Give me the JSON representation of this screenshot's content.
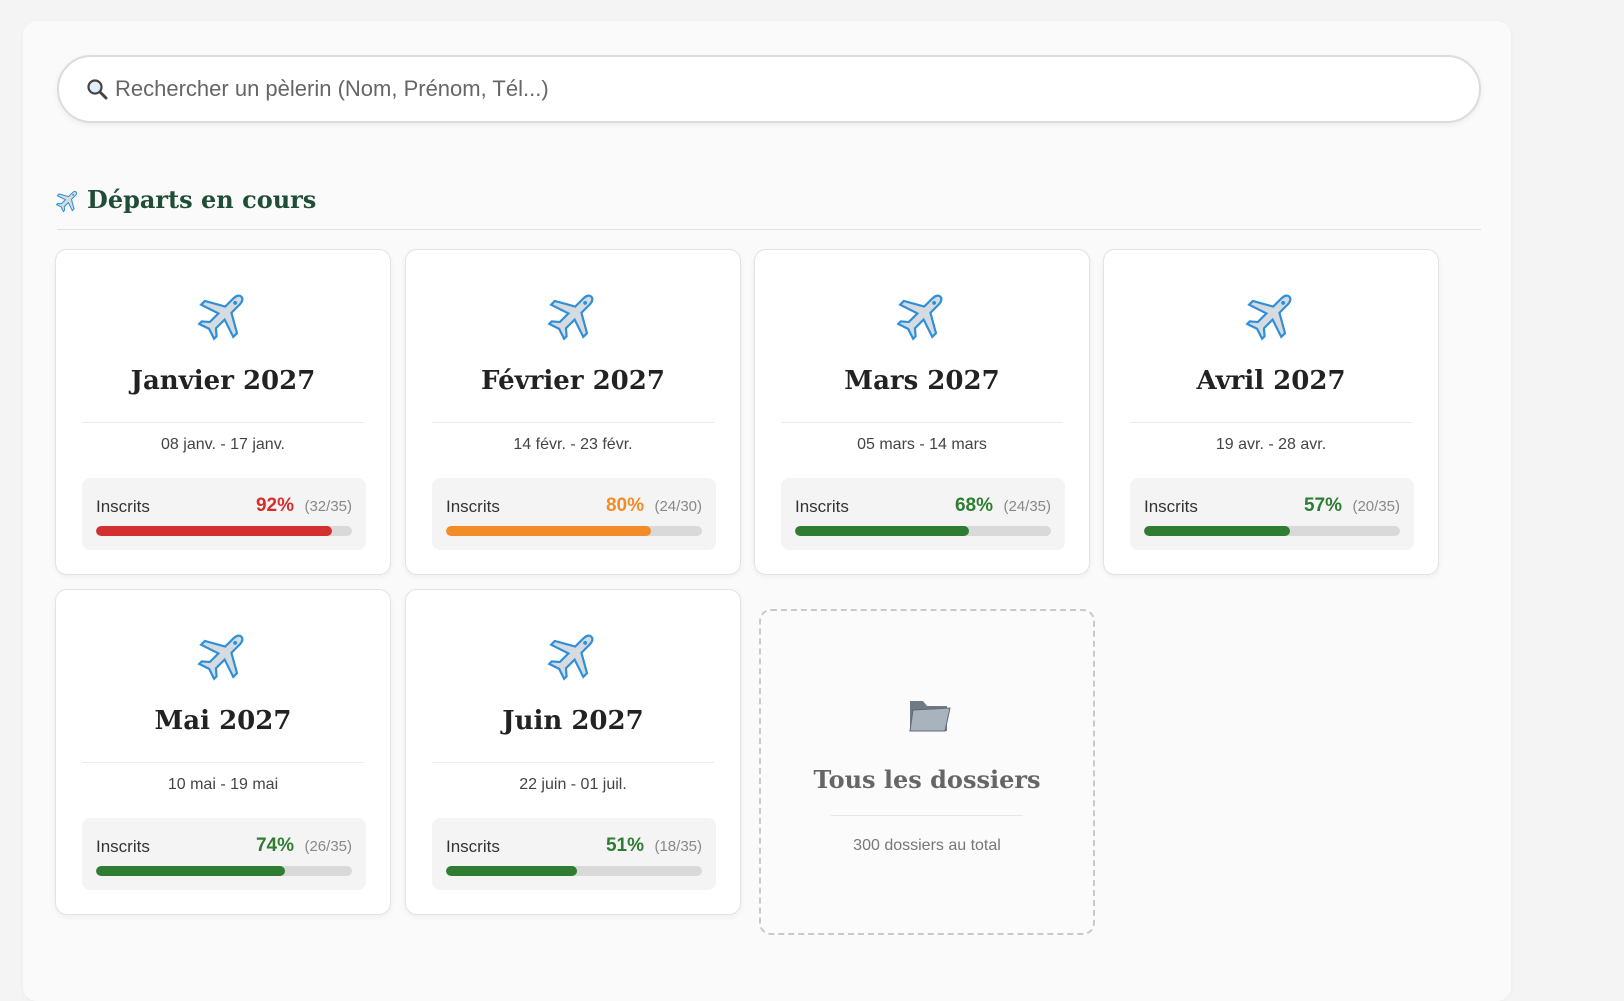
{
  "search": {
    "placeholder": "Rechercher un pèlerin (Nom, Prénom, Tél...)"
  },
  "section": {
    "title": "Départs en cours"
  },
  "colors": {
    "high": "#d32f2f",
    "mid": "#f28c28",
    "ok": "#2e7d32"
  },
  "departures": [
    {
      "title": "Janvier 2027",
      "dates": "08 janv. - 17 janv.",
      "label": "Inscrits",
      "pct": "92%",
      "count": "(32/35)",
      "fill": 0.92,
      "status": "high"
    },
    {
      "title": "Février 2027",
      "dates": "14 févr. - 23 févr.",
      "label": "Inscrits",
      "pct": "80%",
      "count": "(24/30)",
      "fill": 0.8,
      "status": "mid"
    },
    {
      "title": "Mars 2027",
      "dates": "05 mars - 14 mars",
      "label": "Inscrits",
      "pct": "68%",
      "count": "(24/35)",
      "fill": 0.68,
      "status": "ok"
    },
    {
      "title": "Avril 2027",
      "dates": "19 avr. - 28 avr.",
      "label": "Inscrits",
      "pct": "57%",
      "count": "(20/35)",
      "fill": 0.57,
      "status": "ok"
    },
    {
      "title": "Mai 2027",
      "dates": "10 mai - 19 mai",
      "label": "Inscrits",
      "pct": "74%",
      "count": "(26/35)",
      "fill": 0.74,
      "status": "ok"
    },
    {
      "title": "Juin 2027",
      "dates": "22 juin - 01 juil.",
      "label": "Inscrits",
      "pct": "51%",
      "count": "(18/35)",
      "fill": 0.51,
      "status": "ok"
    }
  ],
  "all_folders": {
    "title": "Tous les dossiers",
    "subtitle": "300 dossiers au total"
  }
}
